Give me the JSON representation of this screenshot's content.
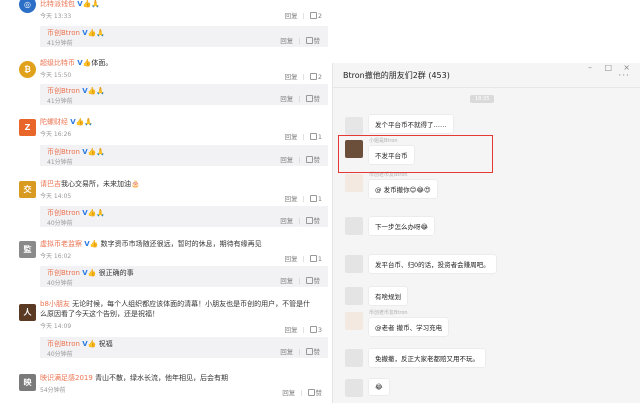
{
  "actions": {
    "reply": "回复",
    "like": "赞"
  },
  "comments": [
    {
      "name": "比特派钱包",
      "badge": "V",
      "emoji": "👍🙏",
      "text": "",
      "time": "今天 13:33",
      "likes": "2",
      "avatar_color": "#2b6fc6",
      "avatar_glyph": "◎",
      "reply": {
        "name": "币创Btron",
        "badge": "V",
        "emoji": "👍🙏",
        "text": "",
        "time": "41分钟前",
        "likes": "赞"
      }
    },
    {
      "name": "超级比特币",
      "badge": "V",
      "emoji": "👍",
      "text": "体面。",
      "time": "今天 15:50",
      "likes": "2",
      "avatar_color": "#e0a21c",
      "avatar_glyph": "₿",
      "reply": {
        "name": "币创Btron",
        "badge": "V",
        "emoji": "👍🙏",
        "text": "",
        "time": "41分钟前",
        "likes": "赞"
      }
    },
    {
      "name": "陀螺财经",
      "badge": "V",
      "emoji": "👍🙏",
      "text": "",
      "time": "今天 16:26",
      "likes": "1",
      "avatar_color": "#e8662a",
      "avatar_glyph": "Z",
      "reply": {
        "name": "币创Btron",
        "badge": "V",
        "emoji": "👍🙏",
        "text": "",
        "time": "41分钟前",
        "likes": "赞"
      }
    },
    {
      "name": "请巴吉",
      "badge": "",
      "emoji": "",
      "text": "我心交易所，未来加油🎂",
      "time": "今天 14:05",
      "likes": "1",
      "avatar_color": "#d99a22",
      "avatar_glyph": "交",
      "reply": {
        "name": "币创Btron",
        "badge": "V",
        "emoji": "👍🙏",
        "text": "",
        "time": "40分钟前",
        "likes": "赞"
      }
    },
    {
      "name": "虚拟币老监察",
      "badge": "V",
      "emoji": "👍",
      "text": "数字资币市场随还很远，暂时的休息，期待有缘再见",
      "time": "今天 16:02",
      "likes": "1",
      "avatar_color": "#8a8a8a",
      "avatar_glyph": "監",
      "reply": {
        "name": "币创Btron",
        "badge": "V",
        "emoji": "👍",
        "text": "很正确的事",
        "time": "40分钟前",
        "likes": "赞"
      }
    },
    {
      "name": "b8小朋友",
      "badge": "",
      "emoji": "",
      "text": "无论时候，每个人组织都应该体面的清幕！小朋友也是币创的用户，不管是什么原因看了今天这个告别，还是祝福！",
      "time": "今天 14:09",
      "likes": "3",
      "avatar_color": "#5a3a22",
      "avatar_glyph": "人",
      "reply": {
        "name": "币创Btron",
        "badge": "V",
        "emoji": "👍",
        "text": "祝福",
        "time": "40分钟前",
        "likes": "赞"
      }
    },
    {
      "name": "映识满足感2019",
      "badge": "",
      "emoji": "",
      "text": "青山不散，绿水长流，他年相见，后会有期",
      "time": "54分钟前",
      "likes": "赞",
      "avatar_color": "#7a7a7a",
      "avatar_glyph": "映"
    }
  ],
  "chat": {
    "title": "Btron撤他的朋友们2群 (453)",
    "more_icon": "···",
    "timestamp": "18:35",
    "messages": [
      {
        "sender": "",
        "text": "发个平台币不就得了……"
      },
      {
        "sender": "小姐是Btron",
        "text": "不发平台币"
      },
      {
        "sender": "币创老币友Btron",
        "text": "@ 发币撤你😊😂😍"
      },
      {
        "sender": "",
        "text": "下一步怎么办呀😂"
      },
      {
        "sender": "",
        "text": "发平台币、归0的话，投资者会赚周吧。"
      },
      {
        "sender": "",
        "text": "有啥规划"
      },
      {
        "sender": "币创老币友Btron",
        "text": "@老者 撤币、学习充电"
      },
      {
        "sender": "",
        "text": "免撤撤，反正大家老都赔又用不玩。"
      },
      {
        "sender": "",
        "text": "😂"
      }
    ]
  }
}
